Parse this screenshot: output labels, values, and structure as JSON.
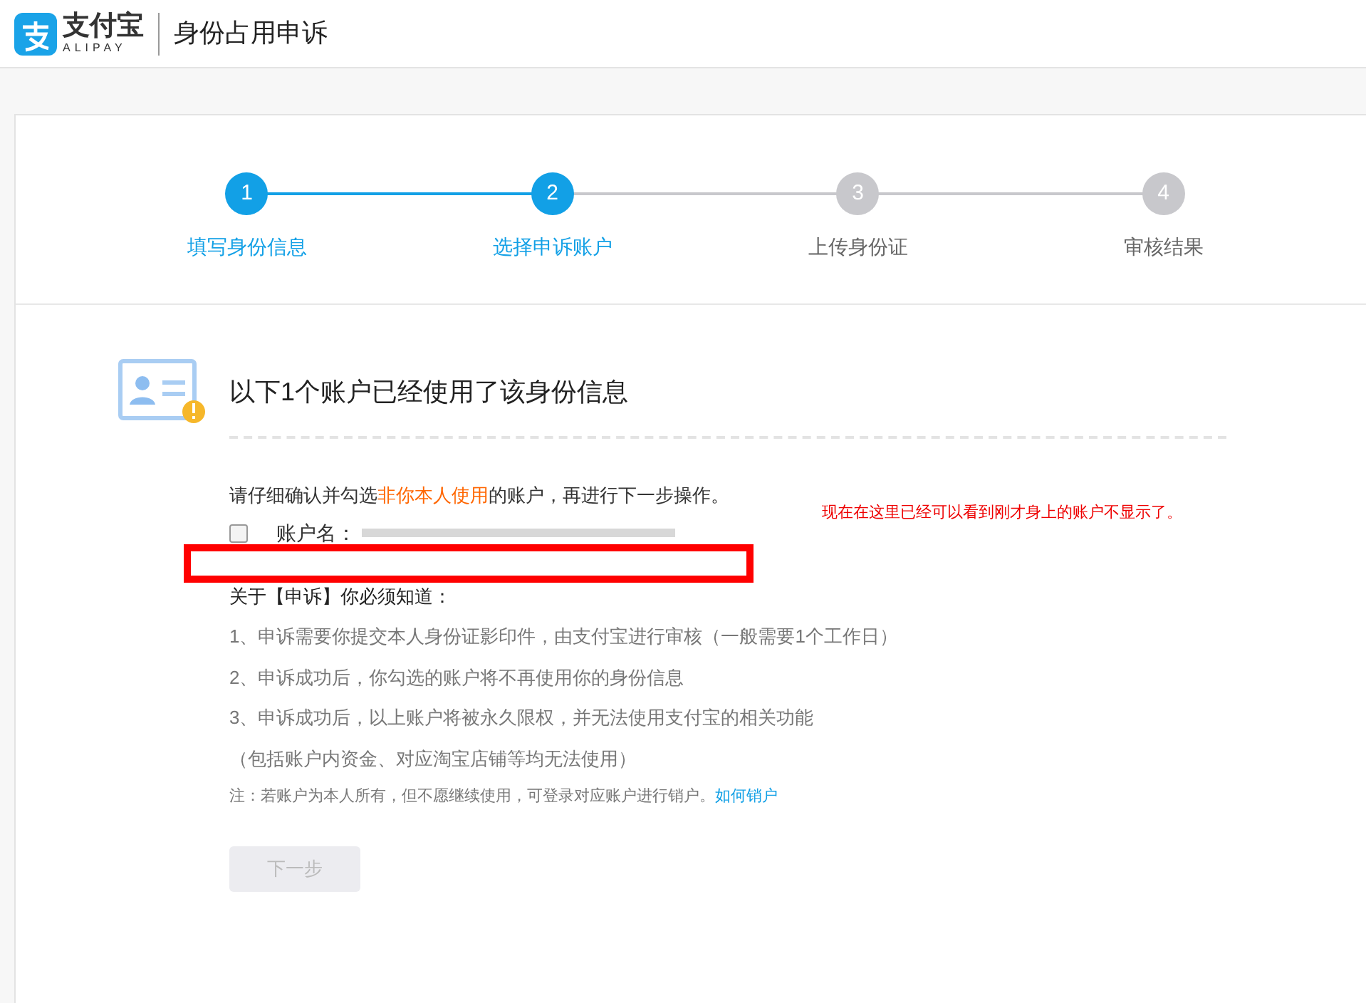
{
  "header": {
    "logo_text": "支付宝",
    "logo_sub": "ALIPAY",
    "title": "身份占用申诉"
  },
  "steps": [
    {
      "number": "1",
      "label": "填写身份信息",
      "active": true
    },
    {
      "number": "2",
      "label": "选择申诉账户",
      "active": true
    },
    {
      "number": "3",
      "label": "上传身份证",
      "active": false
    },
    {
      "number": "4",
      "label": "审核结果",
      "active": false
    }
  ],
  "heading": "以下1个账户已经使用了该身份信息",
  "instruction_parts": [
    "请仔细确认并勾选",
    "非你本人使用",
    "的账户，再进行下一步操作。"
  ],
  "accounts": [
    {
      "label": "账户名：",
      "checked": false
    }
  ],
  "annotation": "现在在这里已经可以看到刚才身上的账户不显示了。",
  "notice_title": "关于【申诉】你必须知道：",
  "notice_items": [
    "1、申诉需要你提交本人身份证影印件，由支付宝进行审核（一般需要1个工作日）",
    "2、申诉成功后，你勾选的账户将不再使用你的身份信息",
    "3、申诉成功后，以上账户将被永久限权，并无法使用支付宝的相关功能",
    "（包括账户内资金、对应淘宝店铺等均无法使用）"
  ],
  "note": "注：若账户为本人所有，但不愿继续使用，可登录对应账户进行销户。",
  "note_link": "如何销户",
  "next_button": {
    "label": "下一步",
    "disabled": true
  }
}
